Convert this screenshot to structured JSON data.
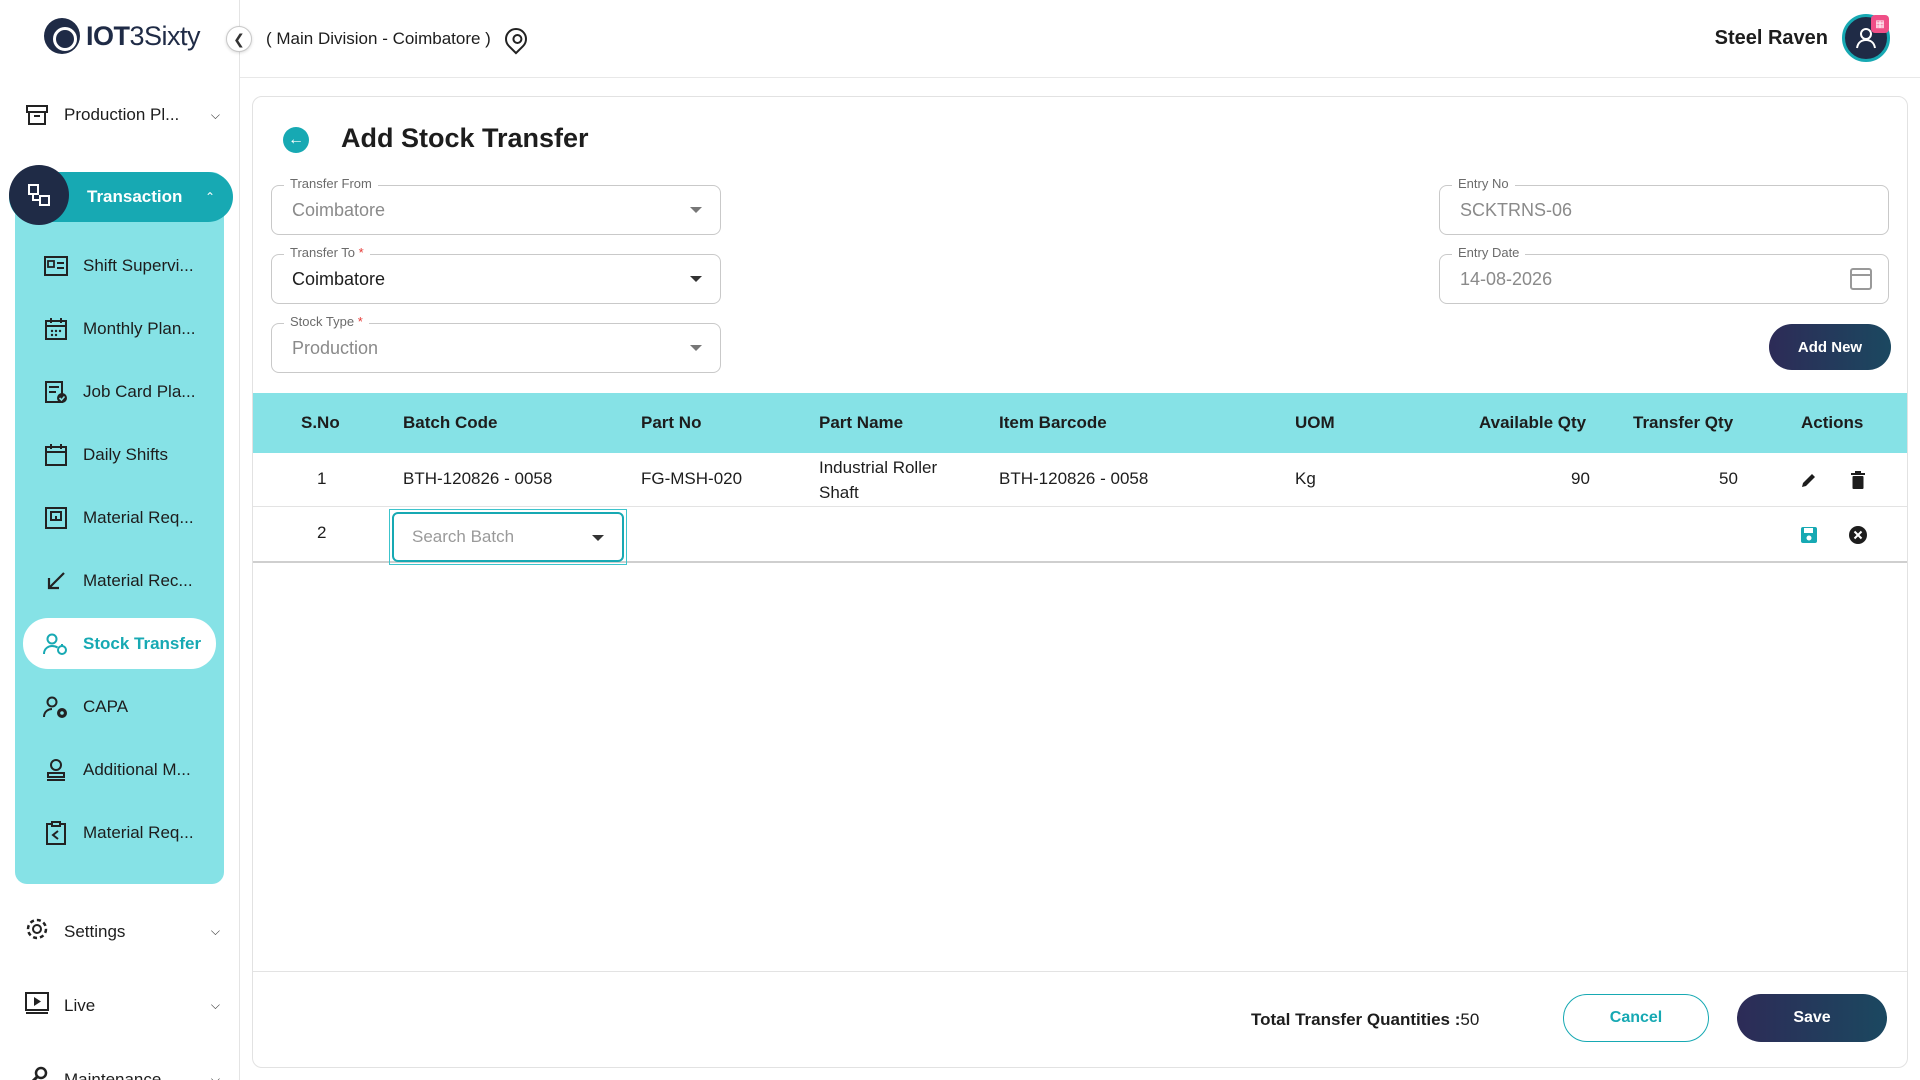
{
  "logo": {
    "text_bold": "IOT",
    "text_regular": "3Sixty"
  },
  "sidebar": {
    "production_plan": "Production Pl...",
    "transaction": "Transaction",
    "items": [
      {
        "label": "Shift Supervi...",
        "icon": "id-card-icon"
      },
      {
        "label": "Monthly Plan...",
        "icon": "calendar-grid-icon"
      },
      {
        "label": "Job Card Pla...",
        "icon": "checklist-icon"
      },
      {
        "label": "Daily Shifts",
        "icon": "calendar-icon"
      },
      {
        "label": "Material Req...",
        "icon": "calendar-box-icon"
      },
      {
        "label": "Material Rec...",
        "icon": "arrow-down-left-icon"
      },
      {
        "label": "Stock Transfer",
        "icon": "user-transfer-icon",
        "active": true
      },
      {
        "label": "CAPA",
        "icon": "user-gear-icon"
      },
      {
        "label": "Additional M...",
        "icon": "user-stamp-icon"
      },
      {
        "label": "Material Req...",
        "icon": "clipboard-arrow-icon"
      }
    ],
    "settings": "Settings",
    "live": "Live",
    "maintenance": "Maintenance"
  },
  "header": {
    "division": "( Main Division - Coimbatore )",
    "user_name": "Steel Raven"
  },
  "form": {
    "title": "Add Stock Transfer",
    "transfer_from": {
      "label": "Transfer From",
      "value": "Coimbatore"
    },
    "transfer_to": {
      "label": "Transfer To",
      "value": "Coimbatore",
      "required": "*"
    },
    "stock_type": {
      "label": "Stock Type",
      "value": "Production",
      "required": "*"
    },
    "entry_no": {
      "label": "Entry No",
      "value": "SCKTRNS-06"
    },
    "entry_date": {
      "label": "Entry Date",
      "value": "14-08-2026"
    },
    "add_new": "Add New"
  },
  "table": {
    "headers": [
      "S.No",
      "Batch Code",
      "Part No",
      "Part Name",
      "Item Barcode",
      "UOM",
      "Available Qty",
      "Transfer Qty",
      "Actions"
    ],
    "rows": [
      {
        "sno": "1",
        "batch_code": "BTH-120826 - 0058",
        "part_no": "FG-MSH-020",
        "part_name_1": "Industrial Roller",
        "part_name_2": "Shaft",
        "item_barcode": "BTH-120826 - 0058",
        "uom": "Kg",
        "available_qty": "90",
        "transfer_qty": "50"
      }
    ],
    "new_row": {
      "sno": "2",
      "batch_placeholder": "Search Batch"
    }
  },
  "footer": {
    "total_label": "Total Transfer Quantities :",
    "total_value": "50",
    "cancel": "Cancel",
    "save": "Save"
  },
  "colors": {
    "accent": "#17a9b3",
    "sidebar_group": "#86e2e6",
    "navy": "#1f2b46"
  }
}
